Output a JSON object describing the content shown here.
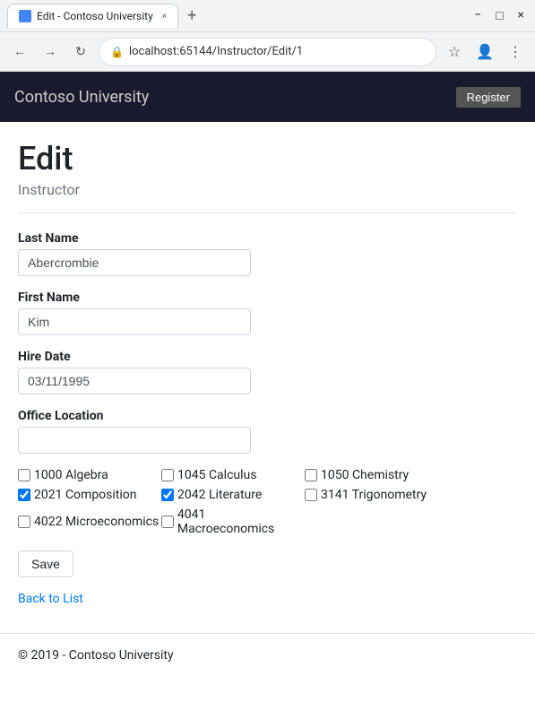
{
  "browser": {
    "tab_title": "Edit - Contoso University",
    "tab_close": "×",
    "new_tab": "+",
    "window_minimize": "−",
    "window_maximize": "□",
    "window_close": "×",
    "back_arrow": "←",
    "forward_arrow": "→",
    "refresh": "↻",
    "address": "localhost:65144/Instructor/Edit/1",
    "star": "☆",
    "menu": "⋮"
  },
  "app": {
    "brand": "Contoso University",
    "navbar_button": "Register"
  },
  "page": {
    "title": "Edit",
    "subtitle": "Instructor",
    "fields": {
      "last_name_label": "Last Name",
      "last_name_value": "Abercrombie",
      "first_name_label": "First Name",
      "first_name_value": "Kim",
      "hire_date_label": "Hire Date",
      "hire_date_value": "03/11/1995",
      "office_location_label": "Office Location",
      "office_location_value": ""
    },
    "courses": [
      {
        "id": "1000",
        "name": "Algebra",
        "checked": false
      },
      {
        "id": "1045",
        "name": "Calculus",
        "checked": false
      },
      {
        "id": "1050",
        "name": "Chemistry",
        "checked": false
      },
      {
        "id": "2021",
        "name": "Composition",
        "checked": true
      },
      {
        "id": "2042",
        "name": "Literature",
        "checked": true
      },
      {
        "id": "3141",
        "name": "Trigonometry",
        "checked": false
      },
      {
        "id": "4022",
        "name": "Microeconomics",
        "checked": false
      },
      {
        "id": "4041",
        "name": "Macroeconomics",
        "checked": false
      }
    ],
    "save_button": "Save",
    "back_link": "Back to List"
  },
  "footer": {
    "text": "© 2019 - Contoso University"
  }
}
